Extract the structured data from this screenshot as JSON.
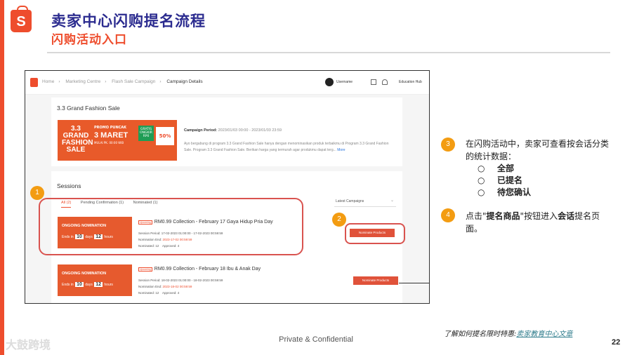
{
  "slide": {
    "title": "卖家中心闪购提名流程",
    "subtitle": "闪购活动入口",
    "logo_letter": "S",
    "confidential": "Private & Confidential",
    "page_number": "22",
    "learn_prefix": "了解如何提名限时特惠:",
    "learn_link": "卖家教育中心文章",
    "watermark": "大鼓跨境"
  },
  "screenshot": {
    "breadcrumbs": [
      "Home",
      "Marketing Centre",
      "Flash Sale Campaign",
      "Campaign Details"
    ],
    "username": "Username",
    "education_hub": "Education Hub",
    "campaign_title": "3.3 Grand Fashion Sale",
    "banner": {
      "big": "3.3 GRAND FASHION SALE",
      "promo": "PROMO PUNCAK",
      "date": "3 MARET",
      "small": "MULAI PK. 00:00 WIB",
      "ongkir": "GRATIS ONGKIR RP0",
      "voucher": "50%"
    },
    "campaign_period_label": "Campaign Period:",
    "campaign_period_value": "2023/01/03 00:00 - 2023/01/03 23:59",
    "description": "Ayo bergabung di program 3.3 Grand Fashion Sale hanya dengan menominasikan produk terbaikmu di Program 3.3 Grand Fashion Sale. Program 3.3 Grand Fashion Sale. Berikan harga yang termurah agar produkmu dapat terg...",
    "more": "More",
    "sessions_heading": "Sessions",
    "tabs": [
      "All (2)",
      "Pending Confirmation (1)",
      "Nominated (1)"
    ],
    "sort_select": "Latest Campaigns",
    "sessions": [
      {
        "status": "ONGOING NOMINATION",
        "ends_in": "Ends in",
        "days": "10",
        "days_label": "days",
        "hours": "12",
        "hours_label": "hours",
        "tag": "Upcoming",
        "title": "RM0.99 Collection - February 17 Gaya Hidup Pria Day",
        "session_period": "Session Period: 17-02-2023 01:00:00 - 17-02-2023 00:59:59",
        "nomination_end_label": "Nomination End:",
        "nomination_end": "2023-17-02 00:59:59",
        "nominated": "Nominated: 12",
        "approved": "Approved: 4",
        "button": "Nominate Products"
      },
      {
        "status": "ONGOING NOMINATION",
        "ends_in": "Ends in",
        "days": "10",
        "days_label": "days",
        "hours": "12",
        "hours_label": "hours",
        "tag": "Upcoming",
        "title": "RM0.99 Collection - February 18 Ibu & Anak Day",
        "session_period": "Session Period: 18-02-2023 01:00:00 - 18-02-2023 00:59:59",
        "nomination_end_label": "Nomination End:",
        "nomination_end": "2023-18-02 00:59:59",
        "nominated": "Nominated: 12",
        "approved": "Approved: 4",
        "button": "Nominate Products"
      }
    ],
    "callouts": [
      "1",
      "2"
    ]
  },
  "notes": {
    "n3": {
      "badge": "3",
      "line1": "在闪购活动中，卖家可查看按会话分类",
      "line2": "的统计数据："
    },
    "bullets": [
      "全部",
      "已提名",
      "待您确认"
    ],
    "bullet_mark": "○",
    "n4": {
      "badge": "4",
      "pre": "点击\"",
      "b1": "提名商品",
      "mid": "\"按钮进入",
      "b2": "会话",
      "post": "提名页",
      "line2": "面。"
    }
  },
  "colors": {
    "brand": "#ee4d2d",
    "title": "#2b2b8f",
    "badge": "#f39c12",
    "highlight": "#d9534f"
  }
}
